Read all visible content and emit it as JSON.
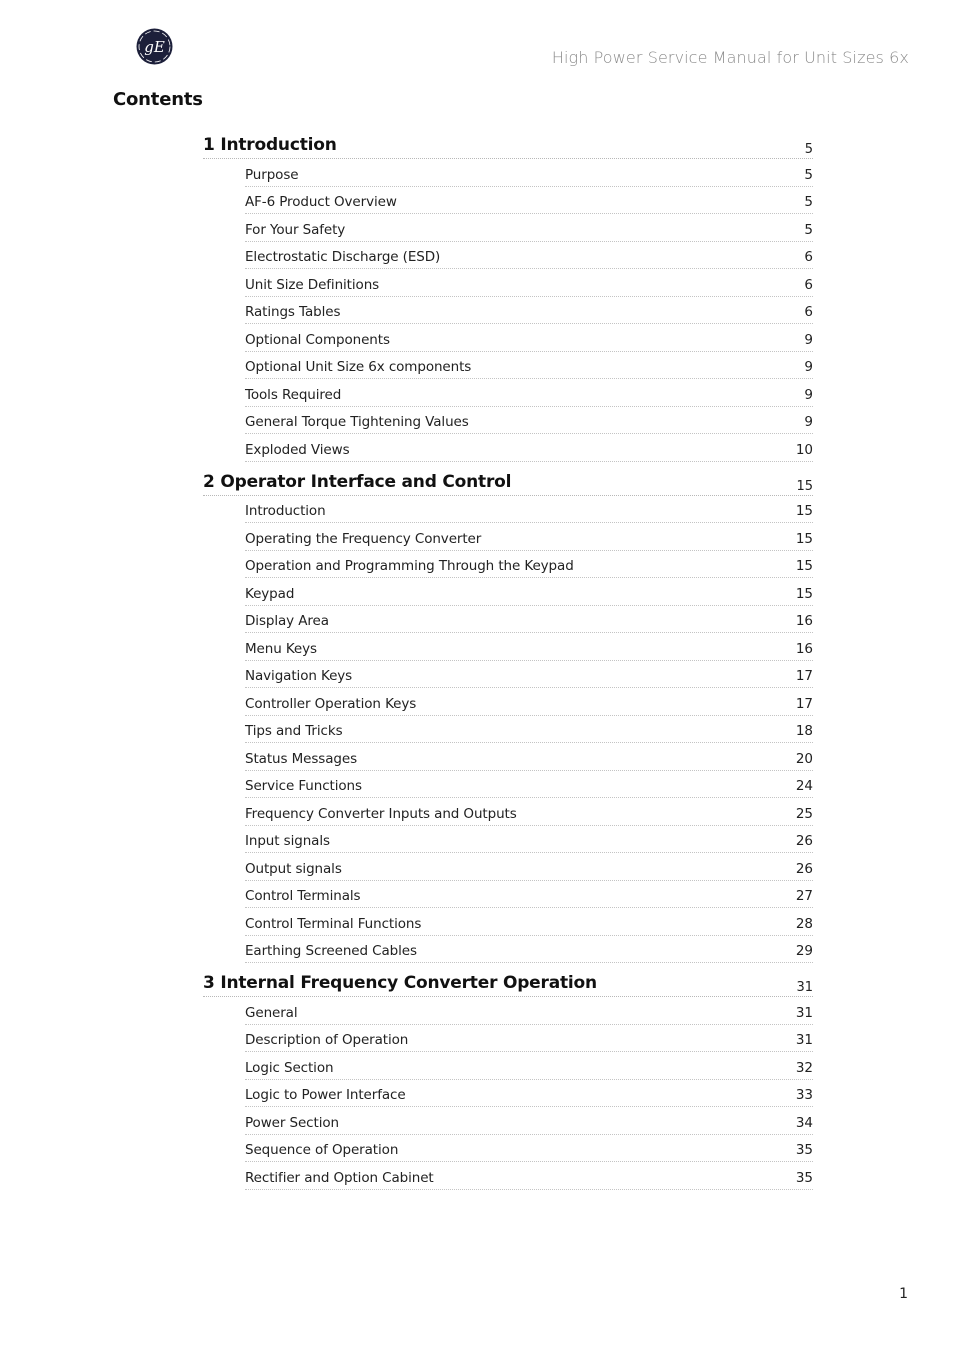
{
  "header": {
    "logo": "ge-monogram-logo",
    "title": "High Power Service Manual for Unit Sizes 6x"
  },
  "contents_heading": "Contents",
  "chapters": [
    {
      "title": "1 Introduction",
      "page": "5",
      "entries": [
        {
          "title": "Purpose",
          "page": "5"
        },
        {
          "title": "AF-6 Product Overview",
          "page": "5"
        },
        {
          "title": "For Your Safety",
          "page": "5"
        },
        {
          "title": "Electrostatic Discharge (ESD)",
          "page": "6"
        },
        {
          "title": "Unit Size Definitions",
          "page": "6"
        },
        {
          "title": "Ratings Tables",
          "page": "6"
        },
        {
          "title": "Optional Components",
          "page": "9"
        },
        {
          "title": "Optional Unit Size 6x components",
          "page": "9"
        },
        {
          "title": "Tools Required",
          "page": "9"
        },
        {
          "title": "General Torque Tightening Values",
          "page": "9"
        },
        {
          "title": "Exploded Views",
          "page": "10"
        }
      ]
    },
    {
      "title": "2 Operator Interface and Control",
      "page": "15",
      "entries": [
        {
          "title": "Introduction",
          "page": "15"
        },
        {
          "title": "Operating the Frequency Converter",
          "page": "15"
        },
        {
          "title": "Operation and Programming Through the Keypad",
          "page": "15"
        },
        {
          "title": "Keypad",
          "page": "15"
        },
        {
          "title": "Display Area",
          "page": "16"
        },
        {
          "title": "Menu Keys",
          "page": "16"
        },
        {
          "title": "Navigation Keys",
          "page": "17"
        },
        {
          "title": "Controller Operation Keys",
          "page": "17"
        },
        {
          "title": "Tips and Tricks",
          "page": "18"
        },
        {
          "title": "Status Messages",
          "page": "20"
        },
        {
          "title": "Service Functions",
          "page": "24"
        },
        {
          "title": "Frequency Converter Inputs and Outputs",
          "page": "25"
        },
        {
          "title": "Input signals",
          "page": "26"
        },
        {
          "title": "Output signals",
          "page": "26"
        },
        {
          "title": "Control Terminals",
          "page": "27"
        },
        {
          "title": "Control Terminal Functions",
          "page": "28"
        },
        {
          "title": "Earthing Screened Cables",
          "page": "29"
        }
      ]
    },
    {
      "title": "3 Internal Frequency Converter Operation",
      "page": "31",
      "entries": [
        {
          "title": "General",
          "page": "31"
        },
        {
          "title": "Description of Operation",
          "page": "31"
        },
        {
          "title": "Logic Section",
          "page": "32"
        },
        {
          "title": "Logic to Power Interface",
          "page": "33"
        },
        {
          "title": "Power Section",
          "page": "34"
        },
        {
          "title": "Sequence of Operation",
          "page": "35"
        },
        {
          "title": "Rectifier and Option Cabinet",
          "page": "35"
        }
      ]
    }
  ],
  "footer": {
    "page_number": "1"
  }
}
